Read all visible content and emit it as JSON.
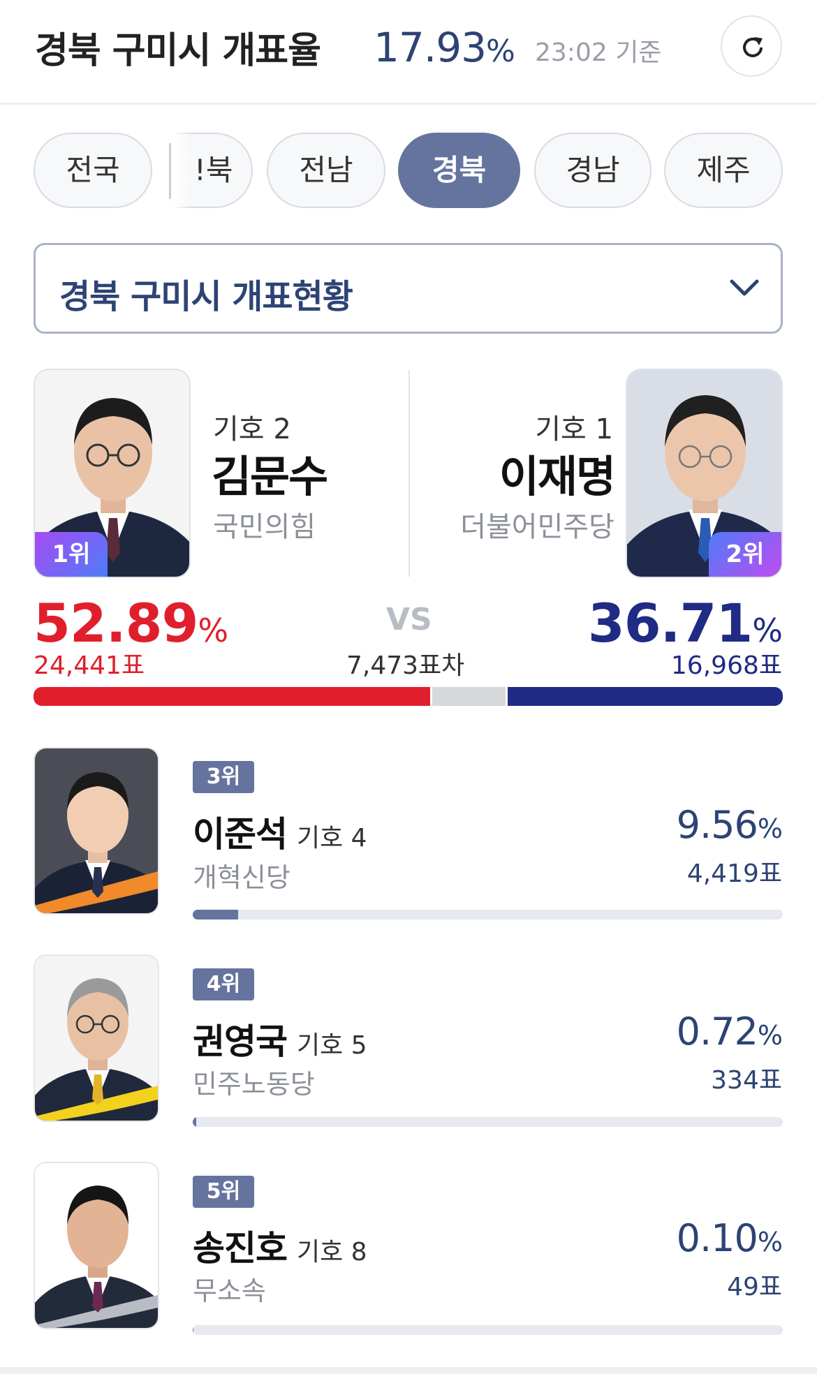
{
  "header": {
    "title": "경북 구미시 개표율",
    "rate": "17.93",
    "rate_unit": "%",
    "time": "23:02 기준"
  },
  "tabs": [
    {
      "label": "전국",
      "active": false
    },
    {
      "label": "!북",
      "active": false
    },
    {
      "label": "전남",
      "active": false
    },
    {
      "label": "경북",
      "active": true
    },
    {
      "label": "경남",
      "active": false
    },
    {
      "label": "제주",
      "active": false
    }
  ],
  "dropdown": {
    "label": "경북 구미시 개표현황"
  },
  "leaders": {
    "left": {
      "rank": "1위",
      "number": "기호 2",
      "name": "김문수",
      "party": "국민의힘",
      "percent": "52.89",
      "percent_unit": "%",
      "votes": "24,441표",
      "vote_share": 52.89
    },
    "right": {
      "rank": "2위",
      "number": "기호 1",
      "name": "이재명",
      "party": "더불어민주당",
      "percent": "36.71",
      "percent_unit": "%",
      "votes": "16,968표",
      "vote_share": 36.71
    },
    "vs": "VS",
    "gap": "7,473표차"
  },
  "others": [
    {
      "rank": "3위",
      "name": "이준석",
      "number": "기호 4",
      "party": "개혁신당",
      "percent": "9.56",
      "percent_unit": "%",
      "votes": "4,419표",
      "vote_share": 9.56
    },
    {
      "rank": "4위",
      "name": "권영국",
      "number": "기호 5",
      "party": "민주노동당",
      "percent": "0.72",
      "percent_unit": "%",
      "votes": "334표",
      "vote_share": 0.72
    },
    {
      "rank": "5위",
      "name": "송진호",
      "number": "기호 8",
      "party": "무소속",
      "percent": "0.10",
      "percent_unit": "%",
      "votes": "49표",
      "vote_share": 0.1
    }
  ],
  "colors": {
    "accent": "#65749f",
    "party_red": "#e01f2d",
    "party_blue": "#1f2b84",
    "text_navy": "#2d4374"
  },
  "icons": {
    "refresh": "refresh-icon",
    "dropdown": "chevron-down-icon"
  }
}
